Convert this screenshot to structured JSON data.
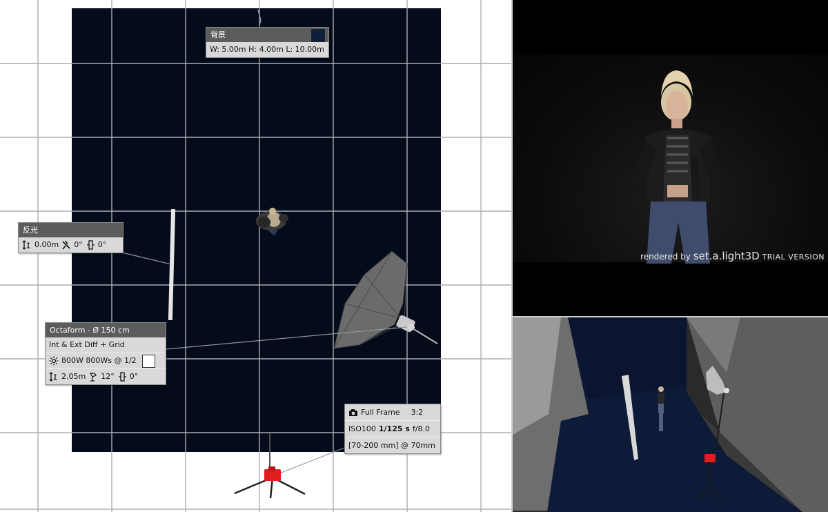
{
  "background_panel": {
    "title": "背景",
    "dims": "W: 5.00m H: 4.00m L: 10.00m",
    "color": "#0d1f3f"
  },
  "reflector_panel": {
    "title": "反光",
    "height": "0.00m",
    "tilt": "0°",
    "rotation": "0°"
  },
  "light_panel": {
    "title": "Octaform - Ø 150 cm",
    "modifier": "Int & Ext Diff + Grid",
    "power": "800W 800Ws @ 1/2",
    "height": "2.05m",
    "tilt": "12°",
    "rotation": "0°"
  },
  "camera_panel": {
    "sensor": "Full Frame",
    "ratio": "3:2",
    "iso": "ISO100",
    "shutter": "1/125 s",
    "aperture": "f/8.0",
    "lens": "[70-200 mm] @ 70mm"
  },
  "watermark": {
    "rendered_by": "rendered by",
    "brand": "set.a.light",
    "brand_3d": "3D",
    "trial": "TRIAL VERSION"
  },
  "icons": [
    "height-icon",
    "tilt-icon",
    "rotation-icon",
    "sun-icon",
    "camera-icon"
  ],
  "colors": {
    "backdrop": "#040b1a",
    "grid": "#a8aeb3",
    "panel_header": "#5c5c5c",
    "panel_body": "#d9d9d9",
    "camera_red": "#e01e1e"
  }
}
